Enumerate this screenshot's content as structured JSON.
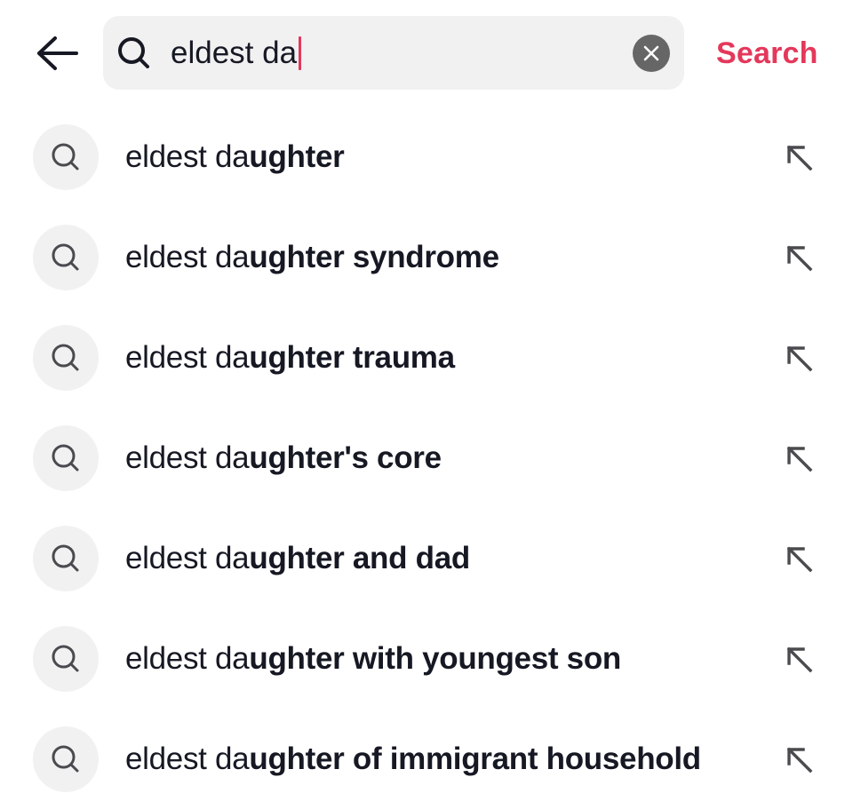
{
  "header": {
    "back_icon": "arrow-left-icon",
    "search": {
      "icon": "search-icon",
      "value": "eldest da",
      "clear_icon": "close-circle-icon"
    },
    "search_button_label": "Search",
    "accent_color": "#e4385b"
  },
  "suggestions": [
    {
      "typed": "eldest da",
      "completion": "ughter",
      "icon": "search-icon",
      "fill_icon": "arrow-up-left-icon"
    },
    {
      "typed": "eldest da",
      "completion": "ughter syndrome",
      "icon": "search-icon",
      "fill_icon": "arrow-up-left-icon"
    },
    {
      "typed": "eldest da",
      "completion": "ughter trauma",
      "icon": "search-icon",
      "fill_icon": "arrow-up-left-icon"
    },
    {
      "typed": "eldest da",
      "completion": "ughter's core",
      "icon": "search-icon",
      "fill_icon": "arrow-up-left-icon"
    },
    {
      "typed": "eldest da",
      "completion": "ughter and dad",
      "icon": "search-icon",
      "fill_icon": "arrow-up-left-icon"
    },
    {
      "typed": "eldest da",
      "completion": "ughter with youngest son",
      "icon": "search-icon",
      "fill_icon": "arrow-up-left-icon"
    },
    {
      "typed": "eldest da",
      "completion": "ughter of immigrant household",
      "icon": "search-icon",
      "fill_icon": "arrow-up-left-icon"
    }
  ]
}
